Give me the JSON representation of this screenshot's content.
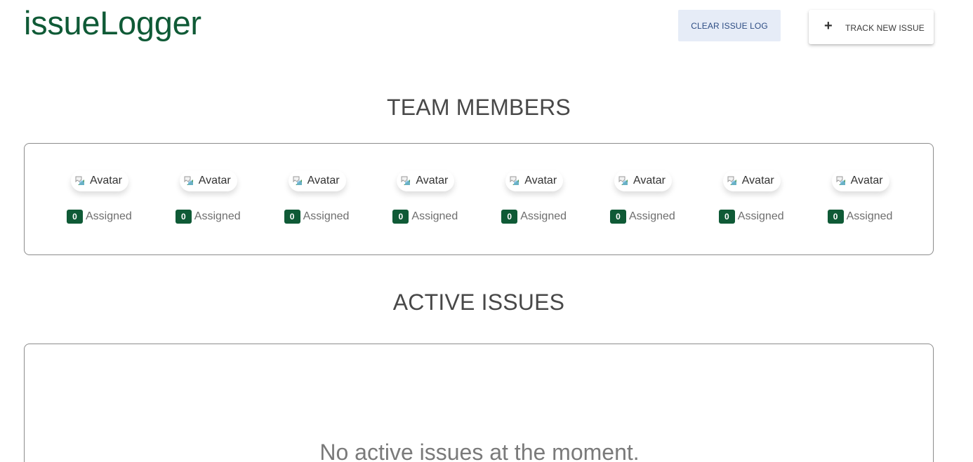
{
  "header": {
    "app_title": "issueLogger",
    "clear_button_label": "Clear issue log",
    "track_button_icon": "plus-icon",
    "track_button_label": "Track new issue"
  },
  "team_section": {
    "heading": "TEAM MEMBERS",
    "members": [
      {
        "avatar_alt": "Avatar",
        "assigned_count": "0",
        "assigned_label": "Assigned"
      },
      {
        "avatar_alt": "Avatar",
        "assigned_count": "0",
        "assigned_label": "Assigned"
      },
      {
        "avatar_alt": "Avatar",
        "assigned_count": "0",
        "assigned_label": "Assigned"
      },
      {
        "avatar_alt": "Avatar",
        "assigned_count": "0",
        "assigned_label": "Assigned"
      },
      {
        "avatar_alt": "Avatar",
        "assigned_count": "0",
        "assigned_label": "Assigned"
      },
      {
        "avatar_alt": "Avatar",
        "assigned_count": "0",
        "assigned_label": "Assigned"
      },
      {
        "avatar_alt": "Avatar",
        "assigned_count": "0",
        "assigned_label": "Assigned"
      },
      {
        "avatar_alt": "Avatar",
        "assigned_count": "0",
        "assigned_label": "Assigned"
      }
    ]
  },
  "active_section": {
    "heading": "ACTIVE ISSUES",
    "empty_message": "No active issues at the moment."
  },
  "colors": {
    "brand_green": "#0f5a36",
    "clear_button_bg": "#e6ecf7",
    "clear_button_text": "#2e4d84",
    "heading_text": "#484848"
  }
}
